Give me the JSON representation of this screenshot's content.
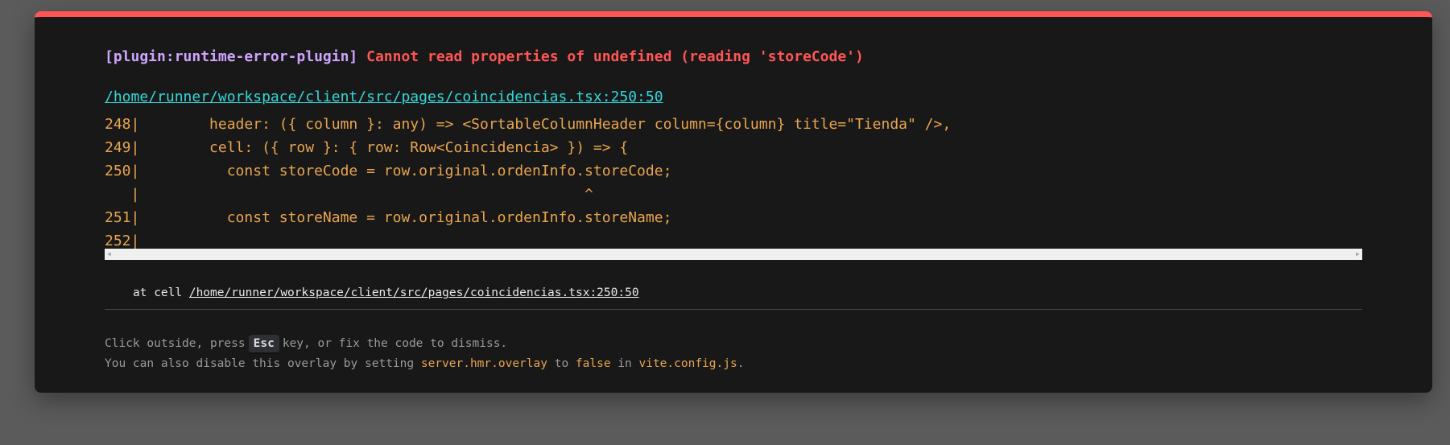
{
  "error": {
    "plugin": "[plugin:runtime-error-plugin]",
    "message": "Cannot read properties of undefined (reading 'storeCode')",
    "file": "/home/runner/workspace/client/src/pages/coincidencias.tsx:250:50"
  },
  "code_frame": [
    "248|        header: ({ column }: any) => <SortableColumnHeader column={column} title=\"Tienda\" />,",
    "249|        cell: ({ row }: { row: Row<Coincidencia> }) => {",
    "250|          const storeCode = row.original.ordenInfo.storeCode;",
    "   |                                                   ^",
    "251|          const storeName = row.original.ordenInfo.storeName;",
    "252|"
  ],
  "stack": {
    "prefix": "at cell ",
    "path": "/home/runner/workspace/client/src/pages/coincidencias.tsx:250:50"
  },
  "tip": {
    "line1_a": "Click outside, press",
    "key": "Esc",
    "line1_b": "key, or fix the code to dismiss.",
    "line2_a": "You can also disable this overlay by setting ",
    "setting": "server.hmr.overlay",
    "line2_b": " to ",
    "value": "false",
    "line2_c": " in ",
    "config": "vite.config.js",
    "line2_d": "."
  },
  "colors": {
    "accent": "#ff5555",
    "plugin": "#cfa4ff",
    "link": "#2dd9da",
    "code": "#e8a54d"
  }
}
